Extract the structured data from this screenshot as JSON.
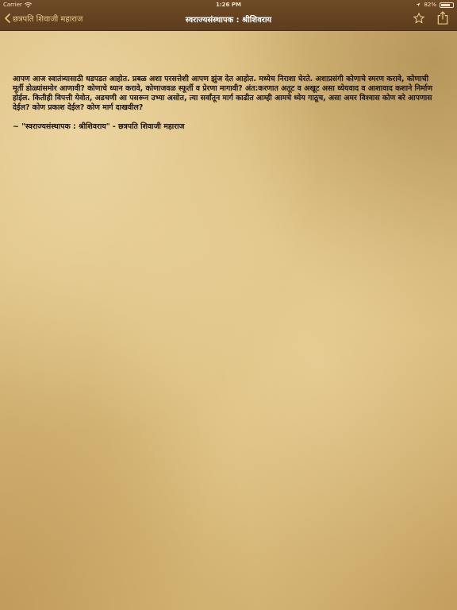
{
  "status_bar": {
    "carrier": "Carrier",
    "time": "1:26 PM",
    "battery_percent": "82%",
    "battery_level": 0.82
  },
  "nav": {
    "back_label": "छत्रपति शिवाजी महाराज",
    "title": "स्वराज्यसंस्थापक : श्रीशिवराय",
    "favorite_icon": "star-outline-icon",
    "share_icon": "share-icon",
    "accent_color": "#e8c987",
    "bar_color": "#5e3d1d"
  },
  "content": {
    "quote": "आपण आज स्वातंत्र्यासाठी धडपडत आहोत. प्रबळ अशा परसत्तेशी आपण झुंज देत आहोत. मध्येच निराशा घेरते. अशाप्रसंगी कोणाचे स्मरण करावे, कोणाची मूर्ती डोळ्यांसमोर आणावी? कोणाचे ध्यान करावे, कोणाजवळ स्फूर्ती व प्रेरणा मागावी? अंत:करणात अतूट व अखूट असा ध्येयवाद व आशावाद कशाने निर्माण होईल. कितीही विपत्ती येवोत, अडचणी आ पसरून उभ्या असोत, त्या सर्वांतून मार्ग काढीत आम्ही आमचे ध्येय गाठूच, असा अमर विश्वास कोण बरे आपणास देईल? कोण प्रकाश देईल? कोण मार्ग दाखवील?",
    "attribution": "~ \"स्वराज्यसंस्थापक : श्रीशिवराय\" - छत्रपति शिवाजी महाराज"
  }
}
